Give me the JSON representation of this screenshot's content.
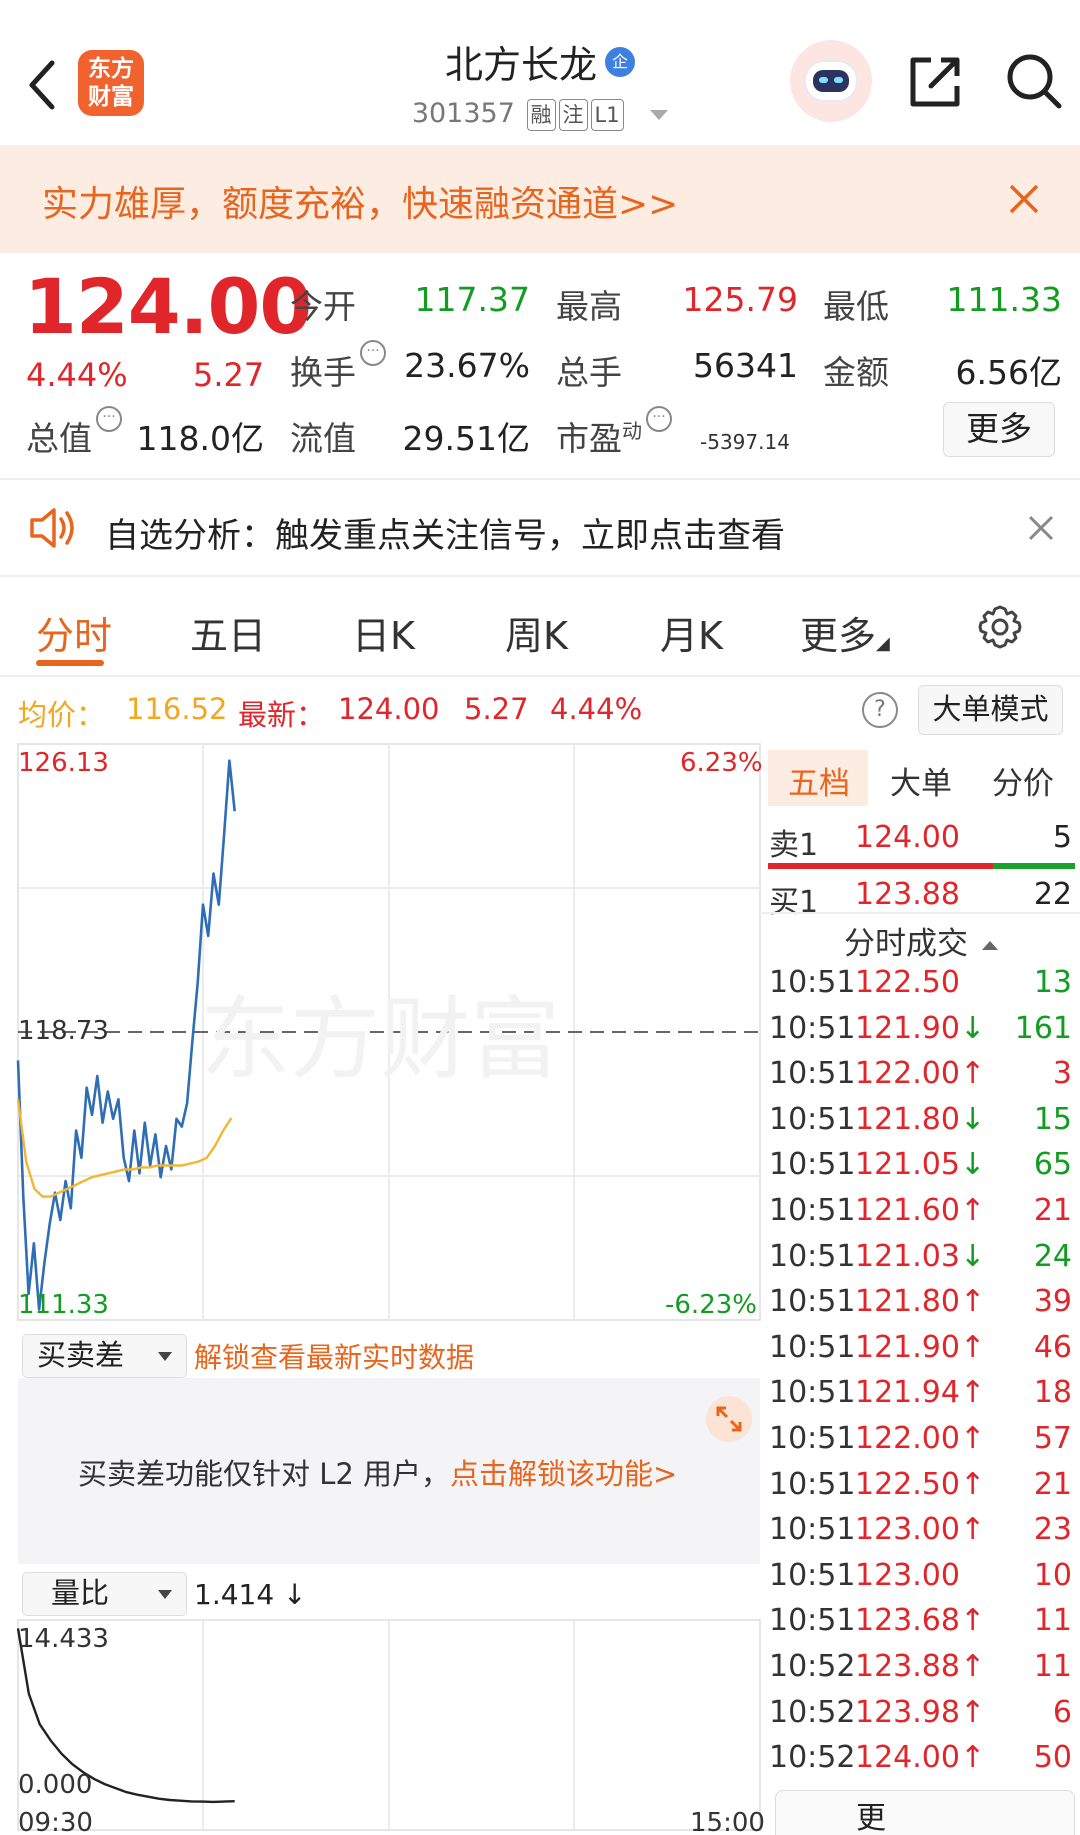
{
  "header": {
    "logo_line1": "东方",
    "logo_line2": "财富",
    "stock_name": "北方长龙",
    "badge": "企",
    "code": "301357",
    "tags": [
      "融",
      "注",
      "L1"
    ]
  },
  "promo": {
    "text": "实力雄厚，额度充裕，快速融资通道>>"
  },
  "quote": {
    "price": "124.00",
    "change_pct": "4.44%",
    "change": "5.27",
    "fields": [
      {
        "label": "今开",
        "value": "117.37",
        "color": "#129c22"
      },
      {
        "label": "最高",
        "value": "125.79",
        "color": "#e0262b"
      },
      {
        "label": "最低",
        "value": "111.33",
        "color": "#129c22"
      },
      {
        "label": "换手",
        "value": "23.67%",
        "color": "#222222"
      },
      {
        "label": "总手",
        "value": "56341",
        "color": "#222222"
      },
      {
        "label": "金额",
        "value": "6.56亿",
        "color": "#222222"
      },
      {
        "label": "总值",
        "value": "118.0亿",
        "color": "#222222"
      },
      {
        "label": "流值",
        "value": "29.51亿",
        "color": "#222222"
      },
      {
        "label": "市盈",
        "value": "-5397.14",
        "color": "#222222"
      }
    ],
    "pe_super": "动",
    "more_label": "更多"
  },
  "analysis": {
    "text": "自选分析：触发重点关注信号，立即点击查看"
  },
  "tabs": [
    "分时",
    "五日",
    "日K",
    "周K",
    "月K",
    "更多"
  ],
  "price_line": {
    "avg_label": "均价：",
    "avg_value": "116.52",
    "latest_label": "最新：",
    "latest_value": "124.00",
    "latest_change": "5.27",
    "latest_pct": "4.44%",
    "big_order_label": "大单模式"
  },
  "chart_data": {
    "type": "line",
    "y_top": "126.13",
    "y_mid": "118.73",
    "y_bottom": "111.33",
    "pct_top": "6.23%",
    "pct_bottom": "-6.23%",
    "ylim": [
      111.33,
      126.13
    ],
    "series": [
      {
        "color": "#2f6db5",
        "values": [
          118.0,
          114.5,
          112.0,
          113.3,
          111.6,
          112.8,
          113.8,
          114.6,
          113.9,
          114.9,
          114.2,
          116.2,
          115.5,
          117.3,
          116.6,
          117.6,
          116.4,
          117.2,
          116.5,
          117.0,
          115.5,
          114.9,
          116.2,
          115.1,
          116.4,
          115.3,
          116.1,
          115.0,
          115.8,
          115.2,
          116.5,
          116.3,
          116.9,
          118.5,
          120.0,
          122.0,
          121.2,
          122.8,
          122.0,
          123.8,
          125.7,
          124.4
        ]
      },
      {
        "color": "#f1b633",
        "values": [
          117.0,
          115.4,
          114.7,
          114.5,
          114.5,
          114.6,
          114.7,
          114.8,
          114.9,
          115.0,
          115.05,
          115.1,
          115.15,
          115.2,
          115.2,
          115.25,
          115.25,
          115.3,
          115.3,
          115.3,
          115.3,
          115.35,
          115.4,
          115.5,
          115.8,
          116.2,
          116.52
        ]
      }
    ],
    "x_start": "09:30",
    "x_end": "15:00"
  },
  "order_book": {
    "tabs": [
      "五档",
      "大单",
      "分价"
    ],
    "sell1": {
      "label": "卖1",
      "price": "124.00",
      "vol": "5"
    },
    "buy1": {
      "label": "买1",
      "price": "123.88",
      "vol": "22"
    },
    "ticks_title": "分时成交",
    "ticks": [
      {
        "time": "10:51",
        "price": "122.50",
        "dir": "",
        "vol": "13",
        "color": "#129c22"
      },
      {
        "time": "10:51",
        "price": "121.90",
        "dir": "↓",
        "vol": "161",
        "color": "#129c22"
      },
      {
        "time": "10:51",
        "price": "122.00",
        "dir": "↑",
        "vol": "3",
        "color": "#e0262b"
      },
      {
        "time": "10:51",
        "price": "121.80",
        "dir": "↓",
        "vol": "15",
        "color": "#129c22"
      },
      {
        "time": "10:51",
        "price": "121.05",
        "dir": "↓",
        "vol": "65",
        "color": "#129c22"
      },
      {
        "time": "10:51",
        "price": "121.60",
        "dir": "↑",
        "vol": "21",
        "color": "#e0262b"
      },
      {
        "time": "10:51",
        "price": "121.03",
        "dir": "↓",
        "vol": "24",
        "color": "#129c22"
      },
      {
        "time": "10:51",
        "price": "121.80",
        "dir": "↑",
        "vol": "39",
        "color": "#e0262b"
      },
      {
        "time": "10:51",
        "price": "121.90",
        "dir": "↑",
        "vol": "46",
        "color": "#e0262b"
      },
      {
        "time": "10:51",
        "price": "121.94",
        "dir": "↑",
        "vol": "18",
        "color": "#e0262b"
      },
      {
        "time": "10:51",
        "price": "122.00",
        "dir": "↑",
        "vol": "57",
        "color": "#e0262b"
      },
      {
        "time": "10:51",
        "price": "122.50",
        "dir": "↑",
        "vol": "21",
        "color": "#e0262b"
      },
      {
        "time": "10:51",
        "price": "123.00",
        "dir": "↑",
        "vol": "23",
        "color": "#e0262b"
      },
      {
        "time": "10:51",
        "price": "123.00",
        "dir": "",
        "vol": "10",
        "color": "#e0262b"
      },
      {
        "time": "10:51",
        "price": "123.68",
        "dir": "↑",
        "vol": "11",
        "color": "#e0262b"
      },
      {
        "time": "10:52",
        "price": "123.88",
        "dir": "↑",
        "vol": "11",
        "color": "#e0262b"
      },
      {
        "time": "10:52",
        "price": "123.98",
        "dir": "↑",
        "vol": "6",
        "color": "#e0262b"
      },
      {
        "time": "10:52",
        "price": "124.00",
        "dir": "↑",
        "vol": "50",
        "color": "#e0262b"
      }
    ],
    "bottom_button": "更"
  },
  "indicator1": {
    "select": "买卖差",
    "unlock_link": "解锁查看最新实时数据",
    "l2_text": "买卖差功能仅针对 L2 用户，",
    "l2_link": "点击解锁该功能>"
  },
  "indicator2": {
    "select": "量比",
    "value": "1.414 ↓",
    "y_top": "14.433",
    "y_bottom": "0.000",
    "values": [
      14.4,
      9.5,
      7.2,
      6.0,
      5.0,
      4.2,
      3.6,
      3.1,
      2.7,
      2.4,
      2.1,
      1.9,
      1.75,
      1.6,
      1.5,
      1.45,
      1.4,
      1.38,
      1.36,
      1.38,
      1.41
    ]
  }
}
